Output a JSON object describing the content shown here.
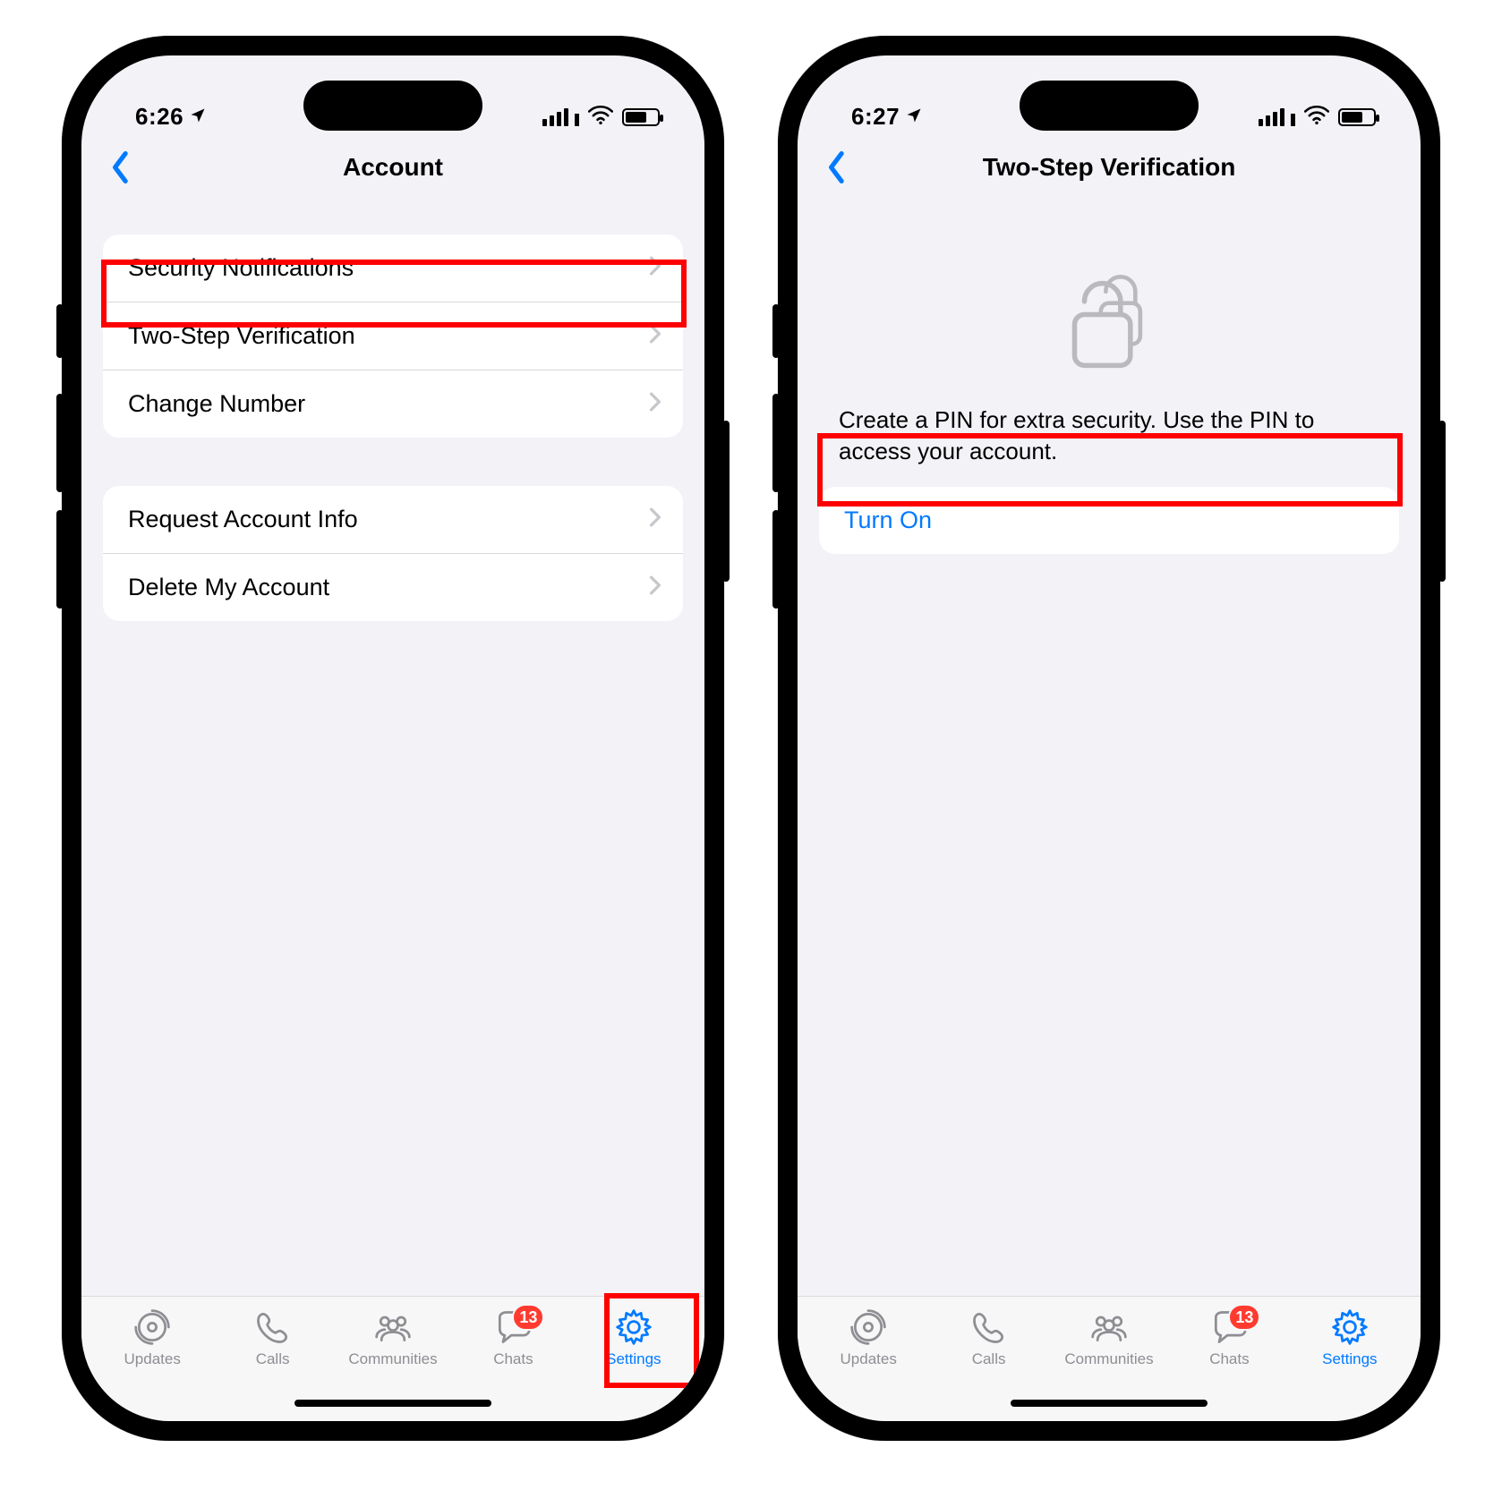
{
  "left": {
    "status": {
      "time": "6:26"
    },
    "nav": {
      "title": "Account"
    },
    "group1": [
      {
        "label": "Security Notifications"
      },
      {
        "label": "Two-Step Verification"
      },
      {
        "label": "Change Number"
      }
    ],
    "group2": [
      {
        "label": "Request Account Info"
      },
      {
        "label": "Delete My Account"
      }
    ]
  },
  "right": {
    "status": {
      "time": "6:27"
    },
    "nav": {
      "title": "Two-Step Verification"
    },
    "description": "Create a PIN for extra security. Use the PIN to access your account.",
    "turn_on_label": "Turn On"
  },
  "tabbar": {
    "items": [
      {
        "label": "Updates"
      },
      {
        "label": "Calls"
      },
      {
        "label": "Communities"
      },
      {
        "label": "Chats",
        "badge": "13"
      },
      {
        "label": "Settings",
        "active": true
      }
    ]
  },
  "colors": {
    "accent": "#007AFF",
    "danger": "#FF3B30",
    "highlight": "#FF0000",
    "bg": "#F2F2F7"
  }
}
